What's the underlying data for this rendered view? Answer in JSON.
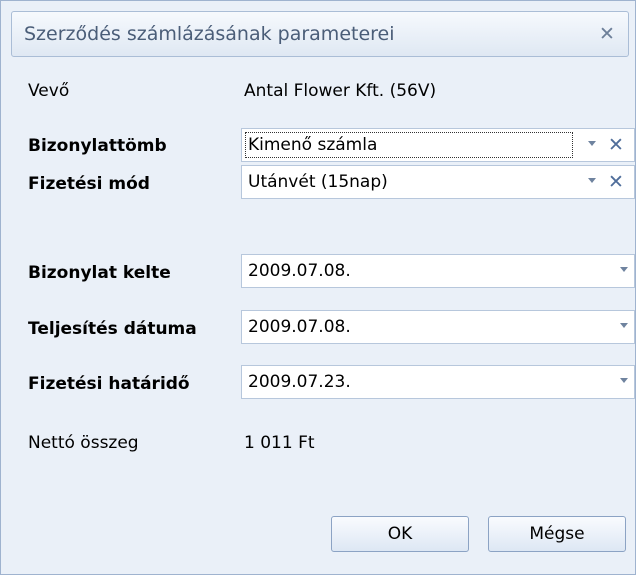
{
  "window": {
    "title": "Szerződés számlázásának parameterei"
  },
  "form": {
    "vevo": {
      "label": "Vevő",
      "value": "Antal Flower Kft. (56V)"
    },
    "bizonylattomb": {
      "label": "Bizonylattömb",
      "value": "Kimenő számla"
    },
    "fizetesi_mod": {
      "label": "Fizetési mód",
      "value": "Utánvét (15nap)"
    },
    "bizonylat_kelte": {
      "label": "Bizonylat kelte",
      "value": "2009.07.08."
    },
    "teljesites_datuma": {
      "label": "Teljesítés dátuma",
      "value": "2009.07.08."
    },
    "fizetesi_hatarido": {
      "label": "Fizetési határidő",
      "value": "2009.07.23."
    },
    "netto_osszeg": {
      "label": "Nettó összeg",
      "value": "1 011 Ft"
    }
  },
  "buttons": {
    "ok": "OK",
    "cancel": "Mégse"
  },
  "icons": {
    "close": "close-icon",
    "dropdown": "chevron-down-icon",
    "clear": "clear-x-icon"
  }
}
